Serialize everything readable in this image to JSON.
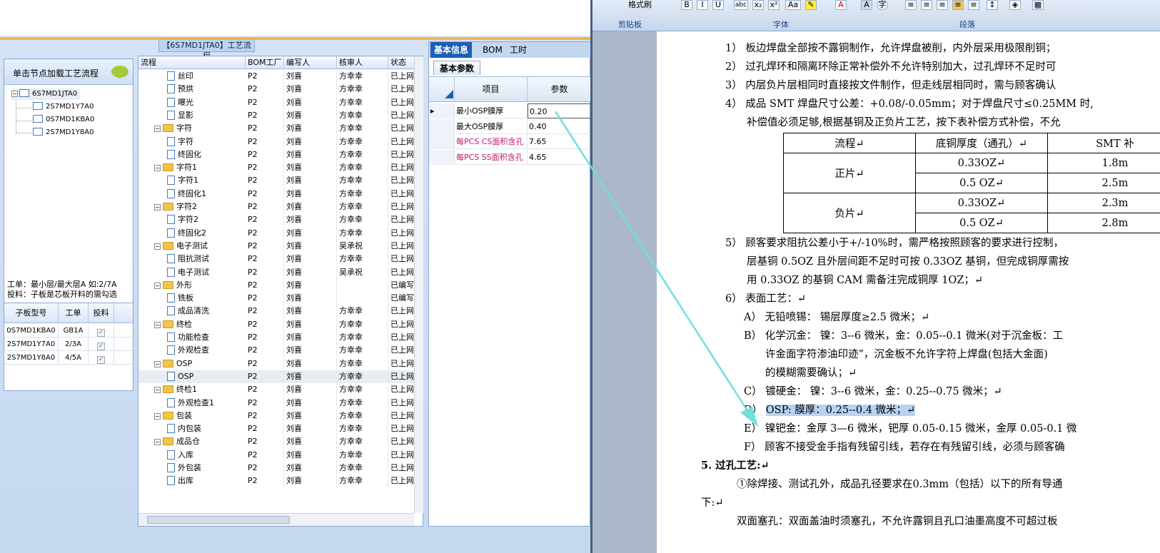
{
  "app": {
    "workflow_title": "【6S7MD1JTA0】工艺流程",
    "left_panel": {
      "header": "单击节点加载工艺流程",
      "tree": [
        {
          "label": "6S7MD1JTA0",
          "level": 0
        },
        {
          "label": "2S7MD1Y7A0",
          "level": 1
        },
        {
          "label": "0S7MD1KBA0",
          "level": 1
        },
        {
          "label": "2S7MD1Y8A0",
          "level": 1
        }
      ],
      "note_line1": "工单：最小层/最大层A 如:2/7A",
      "note_line2": "投料：子板是芯板开料的需勾选",
      "sub_table": {
        "headers": [
          "子板型号",
          "工单",
          "投料"
        ],
        "rows": [
          {
            "model": "0S7MD1KBA0",
            "order": "GB1A",
            "feed": "✓"
          },
          {
            "model": "2S7MD1Y7A0",
            "order": "2/3A",
            "feed": "✓"
          },
          {
            "model": "2S7MD1Y8A0",
            "order": "4/5A",
            "feed": "✓"
          }
        ]
      }
    },
    "grid": {
      "headers": [
        "流程",
        "BOM工厂",
        "编写人",
        "核审人",
        "状态"
      ],
      "rows": [
        {
          "name": "丝印",
          "type": "doc",
          "factory": "P2",
          "author": "刘喜",
          "reviewer": "方幸幸",
          "status": "已上网"
        },
        {
          "name": "预烘",
          "type": "doc",
          "factory": "P2",
          "author": "刘喜",
          "reviewer": "方幸幸",
          "status": "已上网"
        },
        {
          "name": "曝光",
          "type": "doc",
          "factory": "P2",
          "author": "刘喜",
          "reviewer": "方幸幸",
          "status": "已上网"
        },
        {
          "name": "显影",
          "type": "doc",
          "factory": "P2",
          "author": "刘喜",
          "reviewer": "方幸幸",
          "status": "已上网"
        },
        {
          "name": "字符",
          "type": "folder",
          "factory": "P2",
          "author": "刘喜",
          "reviewer": "方幸幸",
          "status": "已上网"
        },
        {
          "name": "字符",
          "type": "doc",
          "factory": "P2",
          "author": "刘喜",
          "reviewer": "方幸幸",
          "status": "已上网"
        },
        {
          "name": "终固化",
          "type": "doc",
          "factory": "P2",
          "author": "刘喜",
          "reviewer": "方幸幸",
          "status": "已上网"
        },
        {
          "name": "字符1",
          "type": "folder",
          "factory": "P2",
          "author": "刘喜",
          "reviewer": "方幸幸",
          "status": "已上网"
        },
        {
          "name": "字符1",
          "type": "doc",
          "factory": "P2",
          "author": "刘喜",
          "reviewer": "方幸幸",
          "status": "已上网"
        },
        {
          "name": "终固化1",
          "type": "doc",
          "factory": "P2",
          "author": "刘喜",
          "reviewer": "方幸幸",
          "status": "已上网"
        },
        {
          "name": "字符2",
          "type": "folder",
          "factory": "P2",
          "author": "刘喜",
          "reviewer": "方幸幸",
          "status": "已上网"
        },
        {
          "name": "字符2",
          "type": "doc",
          "factory": "P2",
          "author": "刘喜",
          "reviewer": "方幸幸",
          "status": "已上网"
        },
        {
          "name": "终固化2",
          "type": "doc",
          "factory": "P2",
          "author": "刘喜",
          "reviewer": "方幸幸",
          "status": "已上网"
        },
        {
          "name": "电子测试",
          "type": "folder",
          "factory": "P2",
          "author": "刘喜",
          "reviewer": "吴承祝",
          "status": "已上网"
        },
        {
          "name": "阻抗测试",
          "type": "doc",
          "factory": "P2",
          "author": "刘喜",
          "reviewer": "方幸幸",
          "status": "已上网"
        },
        {
          "name": "电子测试",
          "type": "doc",
          "factory": "P2",
          "author": "刘喜",
          "reviewer": "吴承祝",
          "status": "已上网"
        },
        {
          "name": "外形",
          "type": "folder",
          "factory": "P2",
          "author": "刘喜",
          "reviewer": "",
          "status": "已编写"
        },
        {
          "name": "铣板",
          "type": "doc",
          "factory": "P2",
          "author": "刘喜",
          "reviewer": "",
          "status": "已编写"
        },
        {
          "name": "成品清洗",
          "type": "doc",
          "factory": "P2",
          "author": "刘喜",
          "reviewer": "方幸幸",
          "status": "已上网"
        },
        {
          "name": "终检",
          "type": "folder",
          "factory": "P2",
          "author": "刘喜",
          "reviewer": "方幸幸",
          "status": "已上网"
        },
        {
          "name": "功能检查",
          "type": "doc",
          "factory": "P2",
          "author": "刘喜",
          "reviewer": "方幸幸",
          "status": "已上网"
        },
        {
          "name": "外观检查",
          "type": "doc",
          "factory": "P2",
          "author": "刘喜",
          "reviewer": "方幸幸",
          "status": "已上网"
        },
        {
          "name": "OSP",
          "type": "folder",
          "factory": "P2",
          "author": "刘喜",
          "reviewer": "方幸幸",
          "status": "已上网"
        },
        {
          "name": "OSP",
          "type": "doc",
          "factory": "P2",
          "author": "刘喜",
          "reviewer": "方幸幸",
          "status": "已上网",
          "selected": true
        },
        {
          "name": "终检1",
          "type": "folder",
          "factory": "P2",
          "author": "刘喜",
          "reviewer": "方幸幸",
          "status": "已上网"
        },
        {
          "name": "外观检查1",
          "type": "doc",
          "factory": "P2",
          "author": "刘喜",
          "reviewer": "方幸幸",
          "status": "已上网"
        },
        {
          "name": "包装",
          "type": "folder",
          "factory": "P2",
          "author": "刘喜",
          "reviewer": "方幸幸",
          "status": "已上网"
        },
        {
          "name": "内包装",
          "type": "doc",
          "factory": "P2",
          "author": "刘喜",
          "reviewer": "方幸幸",
          "status": "已上网"
        },
        {
          "name": "成品仓",
          "type": "folder",
          "factory": "P2",
          "author": "刘喜",
          "reviewer": "方幸幸",
          "status": "已上网"
        },
        {
          "name": "入库",
          "type": "doc",
          "factory": "P2",
          "author": "刘喜",
          "reviewer": "方幸幸",
          "status": "已上网"
        },
        {
          "name": "外包装",
          "type": "doc",
          "factory": "P2",
          "author": "刘喜",
          "reviewer": "方幸幸",
          "status": "已上网"
        },
        {
          "name": "出库",
          "type": "doc",
          "factory": "P2",
          "author": "刘喜",
          "reviewer": "方幸幸",
          "status": "已上网"
        }
      ]
    },
    "info": {
      "tabs": [
        "基本信息",
        "BOM",
        "工时"
      ],
      "subtab": "基本参数",
      "headers": [
        "项目",
        "参数"
      ],
      "params": [
        {
          "item": "最小OSP膜厚",
          "value": "0.20",
          "color": "#000000"
        },
        {
          "item": "最大OSP膜厚",
          "value": "0.40",
          "color": "#000000"
        },
        {
          "item": "每PCS CS面积含孔",
          "value": "7.65",
          "color": "#c0186f"
        },
        {
          "item": "每PCS SS面积含孔",
          "value": "4.65",
          "color": "#c0186f"
        }
      ]
    }
  },
  "word": {
    "ribbon": {
      "groups": [
        "剪贴板",
        "字体",
        "段落"
      ],
      "format_painter": "格式刷",
      "font_buttons": [
        "B",
        "I",
        "U",
        "abc",
        "x₂",
        "x²",
        "Aa",
        "A"
      ]
    },
    "lines": {
      "l1": "1） 板边焊盘全部按不露铜制作，允许焊盘被削，内外层采用极限削铜；",
      "l2": "2） 过孔焊环和隔离环除正常补偿外不允许特别加大，过孔焊环不足时可",
      "l3": "3） 内层负片层相同时直接按文件制作，但走线层相同时，需与顾客确认",
      "l4": "4） 成品 SMT 焊盘尺寸公差：+0.08/-0.05mm；对于焊盘尺寸≤0.25MM 时,",
      "l4b": "补偿值必须足够,根据基铜及正负片工艺，按下表补偿方式补偿，不允",
      "l5": "5） 顾客要求阻抗公差小于+/-10%时，需严格按照顾客的要求进行控制，",
      "l5b": "层基铜 0.5OZ 且外层间距不足时可按 0.33OZ 基铜，但完成铜厚需按",
      "l5c": "用 0.33OZ 的基铜 CAM 需备注完成铜厚 1OZ；↵",
      "l6": "6） 表面工艺：↵",
      "lA": "A） 无铅喷锡：  锡层厚度≥2.5 微米；↵",
      "lB": "B） 化学沉金：  镍：3--6 微米，金：0.05--0.1 微米(对于沉金板：工",
      "lB2": "许金面字符渗油印迹”，沉金板不允许字符上焊盘(包括大金面)",
      "lB3": "的模糊需要确认；↵",
      "lC": "C） 镀硬金：     镍：3--6 微米，金：0.25--0.75 微米；↵",
      "lD1": "D） ",
      "lD2": "OSP:        膜厚：0.25--0.4 微米；↵",
      "lE": "E） 镍钯金：金厚 3—6 微米，钯厚 0.05-0.15 微米，金厚 0.05-0.1 微",
      "lF": "F） 顾客不接受金手指有残留引线，若存在有残留引线，必须与顾客确",
      "h5": "5.   过孔工艺:↵",
      "p1": "①除焊接、测试孔外，成品孔径要求在0.3mm（包括）以下的所有导通",
      "p1b": "下:↵",
      "p2": "双面塞孔：双面盖油时须塞孔，不允许露铜且孔口油墨高度不可超过板"
    },
    "table": {
      "headers": [
        "流程↵",
        "底铜厚度（通孔）↵",
        "SMT 补"
      ],
      "rows": [
        {
          "group": "正片↵",
          "thick": "0.33OZ↵",
          "val": "1.8m"
        },
        {
          "group": "",
          "thick": "0.5 OZ↵",
          "val": "2.5m"
        },
        {
          "group": "负片↵",
          "thick": "0.33OZ↵",
          "val": "2.3m"
        },
        {
          "group": "",
          "thick": "0.5 OZ↵",
          "val": "2.8m"
        }
      ]
    }
  }
}
